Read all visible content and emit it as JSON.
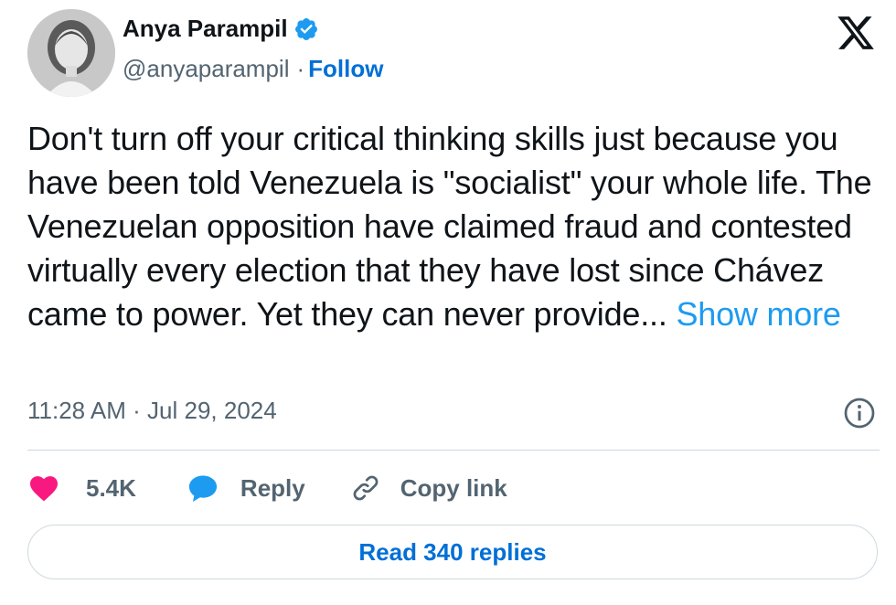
{
  "author": {
    "name": "Anya Parampil",
    "handle": "@anyaparampil",
    "separator": "·",
    "follow_label": "Follow"
  },
  "tweet": {
    "text": "Don't turn off your critical thinking skills just because you have been told Venezuela is \"socialist\" your whole life. The Venezuelan opposition have claimed fraud and contested virtually every election that they have lost since Chávez came to power. Yet they can never provide...",
    "show_more_label": "Show more",
    "timestamp": "11:28 AM · Jul 29, 2024"
  },
  "actions": {
    "likes_count": "5.4K",
    "reply_label": "Reply",
    "copy_link_label": "Copy link"
  },
  "read_replies_label": "Read 340 replies",
  "icons": {
    "verified": "verified-badge-icon",
    "platform": "x-logo-icon",
    "info": "info-icon",
    "like": "heart-icon",
    "reply": "speech-bubble-icon",
    "copy_link": "link-icon"
  },
  "colors": {
    "accent": "#1d9bf0",
    "follow": "#006fd6",
    "like": "#f91880",
    "text": "#0f1419",
    "muted": "#536471",
    "border": "#cfd9de"
  }
}
